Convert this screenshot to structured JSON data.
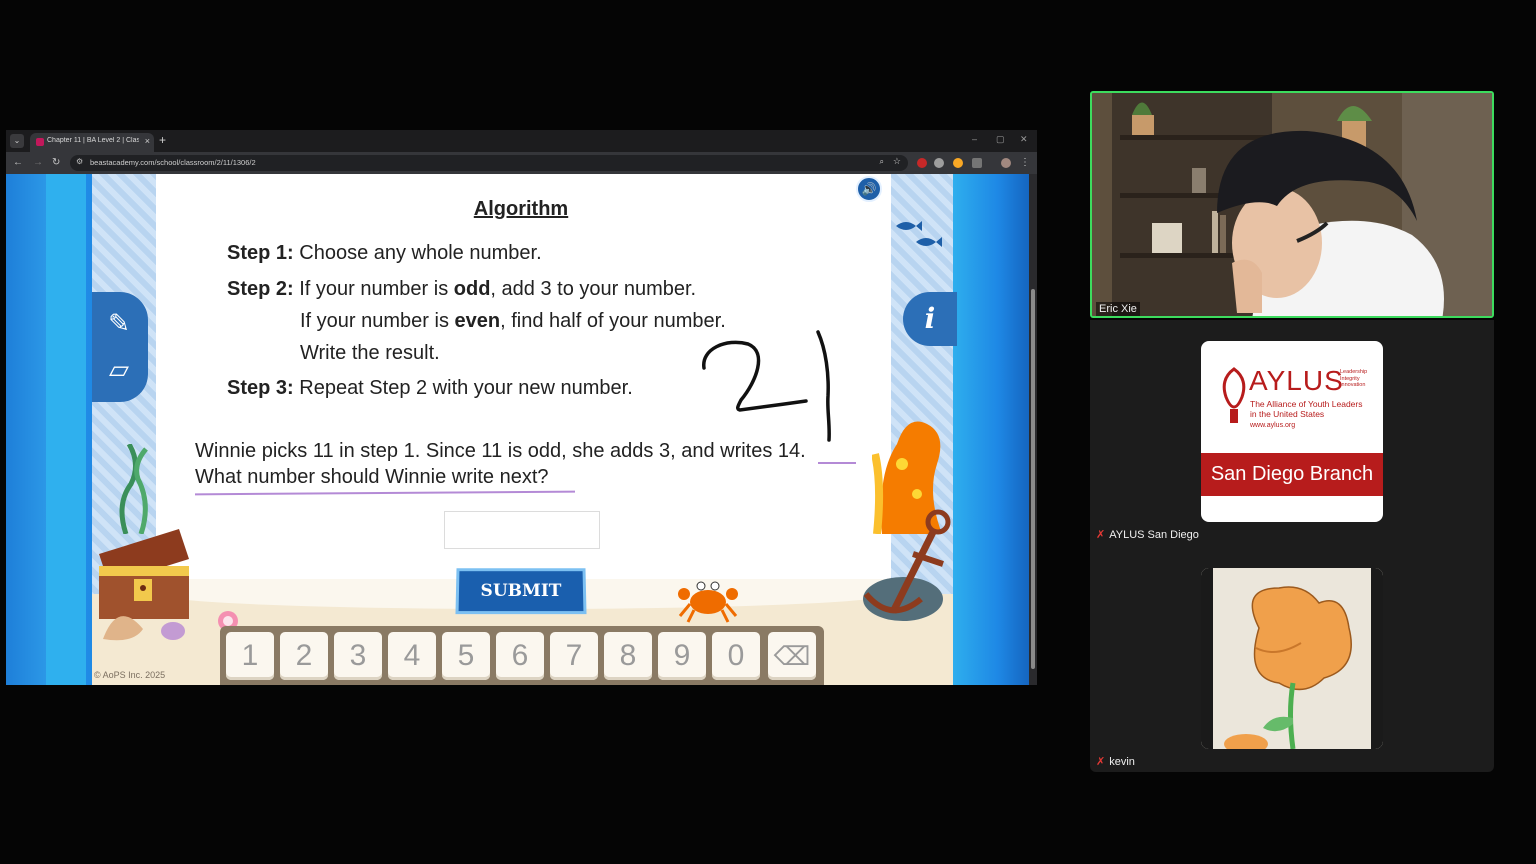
{
  "browser": {
    "tab_title": "Chapter 11 | BA Level 2 | Classr",
    "tab_close": "×",
    "new_tab": "+",
    "url": "beastacademy.com/school/classroom/2/11/1306/2",
    "window_controls": [
      "–",
      "▢",
      "✕"
    ]
  },
  "lesson": {
    "title": "Algorithm",
    "steps": [
      {
        "label": "Step 1:",
        "text": "Choose any whole number."
      },
      {
        "label": "Step 2:",
        "text_pre": "If your number is ",
        "text_bold": "odd",
        "text_post": ", add 3 to your number."
      },
      {
        "label": "Step 3:",
        "text": "Repeat Step 2 with your new number."
      }
    ],
    "step2_line2_pre": "If your number is ",
    "step2_line2_bold": "even",
    "step2_line2_post": ", find half of your number.",
    "step2_line3": "Write the result.",
    "question_line1": "Winnie picks 11 in step 1. Since 11 is odd, she adds 3, and writes 14.",
    "question_line2": "What number should Winnie write next?",
    "answer_value": "",
    "submit_label": "SUBMIT",
    "info_label": "i",
    "keypad_keys": [
      "1",
      "2",
      "3",
      "4",
      "5",
      "6",
      "7",
      "8",
      "9",
      "0"
    ],
    "backspace_icon": "⌫",
    "copyright": "© AoPS Inc. 2025"
  },
  "participants": [
    {
      "name": "Eric Xie",
      "muted": false,
      "active_speaker": true
    },
    {
      "name": "AYLUS San Diego",
      "muted": true
    },
    {
      "name": "kevin",
      "muted": true
    }
  ],
  "aylus_logo": {
    "wordmark": "AYLUS",
    "tagline": [
      "Leadership",
      "Integrity",
      "Innovation"
    ],
    "fullname": [
      "The Alliance of Youth Leaders",
      "in the United States"
    ],
    "url": "www.aylus.org",
    "branch": "San Diego Branch"
  },
  "colors": {
    "active_speaker_border": "#3ddc5e",
    "aylus_red": "#b71c1c",
    "submit_blue": "#1a5fae",
    "question_underline": "#b48ad6"
  }
}
